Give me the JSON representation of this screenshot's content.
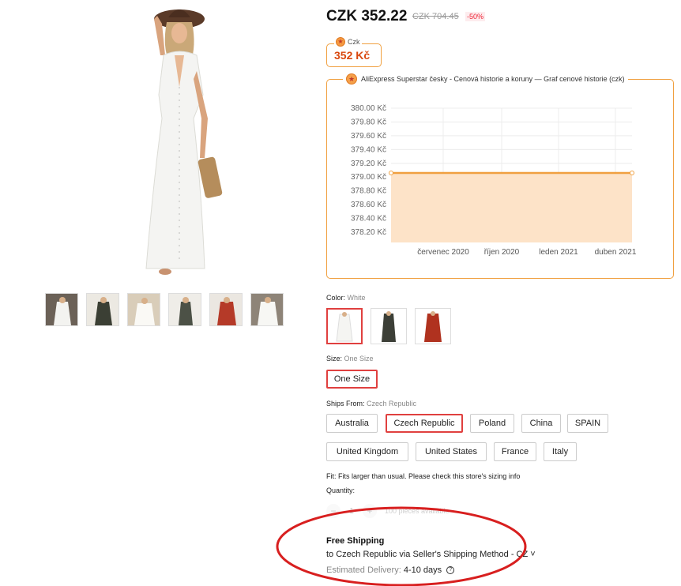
{
  "product": {
    "price": "CZK 352.22",
    "old_price": "CZK 704.45",
    "discount": "-50%",
    "thumbnail_count": 6
  },
  "czk_badge": {
    "label": "Czk",
    "value": "352 Kč",
    "icon": "star-badge-icon"
  },
  "chart_data": {
    "type": "area",
    "title": "AliExpress Superstar česky - Cenová historie a koruny — Graf cenové historie (czk)",
    "x_tick_labels": [
      "červenec 2020",
      "říjen 2020",
      "leden 2021",
      "duben 2021"
    ],
    "y_tick_labels": [
      "380.00 Kč",
      "379.80 Kč",
      "379.60 Kč",
      "379.40 Kč",
      "379.20 Kč",
      "379.00 Kč",
      "378.80 Kč",
      "378.60 Kč",
      "378.40 Kč",
      "378.20 Kč"
    ],
    "ylim": [
      378.2,
      380.0
    ],
    "x": [
      "start",
      "end"
    ],
    "values": [
      379.05,
      379.05
    ],
    "line_color": "#f0a040",
    "fill_color": "#fde3c8",
    "grid": true
  },
  "color": {
    "label": "Color:",
    "selected": "White",
    "options": [
      "White",
      "Dark",
      "Red"
    ]
  },
  "size": {
    "label": "Size:",
    "selected": "One Size",
    "options": [
      "One Size"
    ]
  },
  "ships_from": {
    "label": "Ships From:",
    "selected": "Czech Republic",
    "options": [
      "Australia",
      "Czech Republic",
      "Poland",
      "China",
      "SPAIN",
      "United Kingdom",
      "United States",
      "France",
      "Italy"
    ]
  },
  "fit_text": "Fit: Fits larger than usual. Please check this store's sizing info",
  "quantity": {
    "label": "Quantity:",
    "value": "1",
    "minus": "−",
    "plus": "+",
    "available": "100 pieces available"
  },
  "shipping": {
    "title": "Free Shipping",
    "destination": "to Czech Republic via Seller's Shipping Method - CZ ˅",
    "delivery_label": "Estimated Delivery:",
    "delivery_value": "4-10 days",
    "help_icon": "question-icon"
  },
  "colors": {
    "accent_red": "#e0403f",
    "orange": "#f0a040",
    "annotation_red": "#d81f1f"
  }
}
